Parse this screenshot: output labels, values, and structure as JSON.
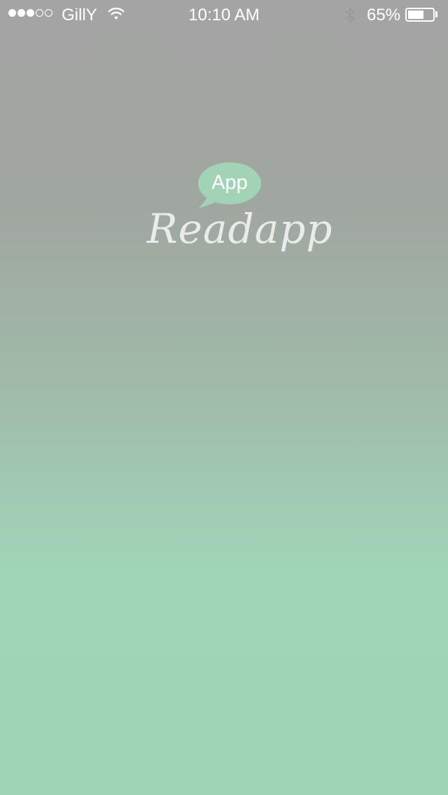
{
  "status_bar": {
    "signal_strength": 3,
    "signal_max": 5,
    "carrier": "GillY",
    "wifi_icon": "wifi-icon",
    "time": "10:10 AM",
    "bluetooth_icon": "bluetooth-icon",
    "battery_percent_label": "65%",
    "battery_level": 0.65
  },
  "splash": {
    "bubble_label": "App",
    "app_name": "Readapp"
  },
  "colors": {
    "top_gray": "#a4a4a4",
    "bottom_mint": "#9fd4b6",
    "bubble_green": "#a2d3b6",
    "wordmark": "#e9ecea"
  }
}
